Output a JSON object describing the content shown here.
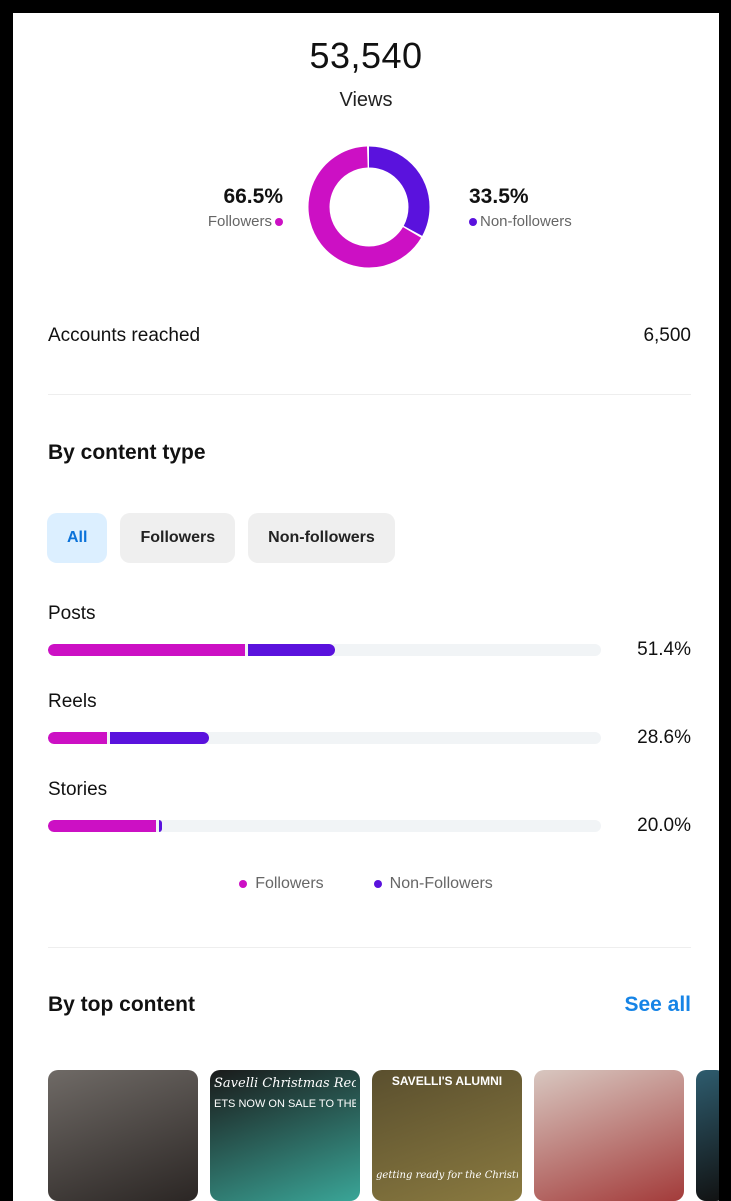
{
  "summary": {
    "views_total": "53,540",
    "views_label": "Views",
    "followers_pct": "66.5%",
    "followers_label": "Followers",
    "non_followers_pct": "33.5%",
    "non_followers_label": "Non-followers",
    "followers_fraction": 0.665,
    "non_followers_fraction": 0.335
  },
  "reach": {
    "label": "Accounts reached",
    "value": "6,500"
  },
  "by_content_type": {
    "title": "By content type",
    "chips": [
      {
        "label": "All",
        "selected": true
      },
      {
        "label": "Followers",
        "selected": false
      },
      {
        "label": "Non-followers",
        "selected": false
      }
    ],
    "rows": [
      {
        "name": "Posts",
        "percent": "51.4%",
        "followers_share": 0.357,
        "non_followers_share": 0.157
      },
      {
        "name": "Reels",
        "percent": "28.6%",
        "followers_share": 0.107,
        "non_followers_share": 0.179
      },
      {
        "name": "Stories",
        "percent": "20.0%",
        "followers_share": 0.196,
        "non_followers_share": 0.004
      }
    ],
    "legend": {
      "followers": "Followers",
      "non_followers": "Non-Followers"
    }
  },
  "by_top_content": {
    "title": "By top content",
    "see_all": "See all",
    "thumbnails": [
      {
        "caption": "",
        "colors": [
          "#6f6a66",
          "#2b2624"
        ]
      },
      {
        "caption": "Savelli Christmas Recital",
        "subcaption": "ETS NOW ON SALE TO THE PUB",
        "colors": [
          "#1a1a1a",
          "#3aa597"
        ]
      },
      {
        "caption": "SAVELLI'S ALUMNI",
        "subcaption": "getting ready for the Christmas Recital",
        "colors": [
          "#5a4f2e",
          "#8a7a40"
        ]
      },
      {
        "caption": "",
        "colors": [
          "#d8c7c0",
          "#a33b3a"
        ]
      },
      {
        "caption": "",
        "colors": [
          "#2e5c6e",
          "#111"
        ]
      }
    ]
  },
  "colors": {
    "followers": "#cc10c4",
    "non_followers": "#5a12dd",
    "accent_blue": "#1684e6",
    "track": "#f1f4f6"
  }
}
